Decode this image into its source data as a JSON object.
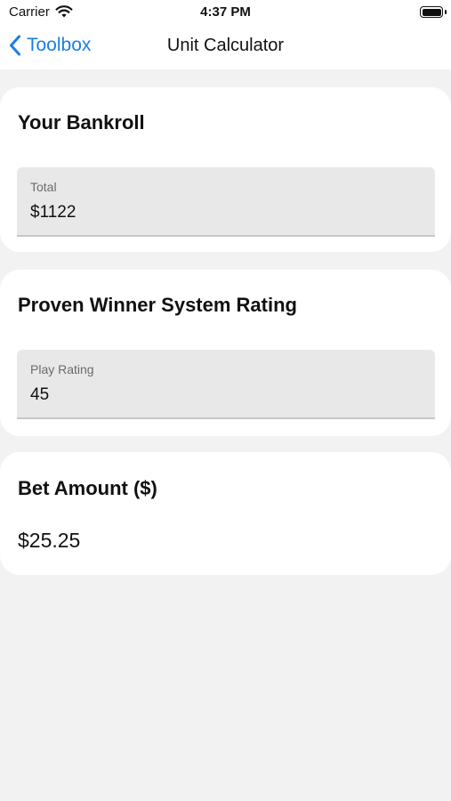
{
  "status_bar": {
    "carrier": "Carrier",
    "time": "4:37 PM"
  },
  "nav": {
    "back_label": "Toolbox",
    "title": "Unit Calculator",
    "accent_color": "#1a7fe3"
  },
  "bankroll": {
    "title": "Your Bankroll",
    "field_label": "Total",
    "field_value": "$1122"
  },
  "rating": {
    "title": "Proven Winner System Rating",
    "field_label": "Play Rating",
    "field_value": "45"
  },
  "bet": {
    "title": "Bet Amount ($)",
    "value": "$25.25"
  },
  "icons": {
    "back": "chevron-left-icon",
    "wifi": "wifi-icon",
    "battery": "battery-icon"
  }
}
